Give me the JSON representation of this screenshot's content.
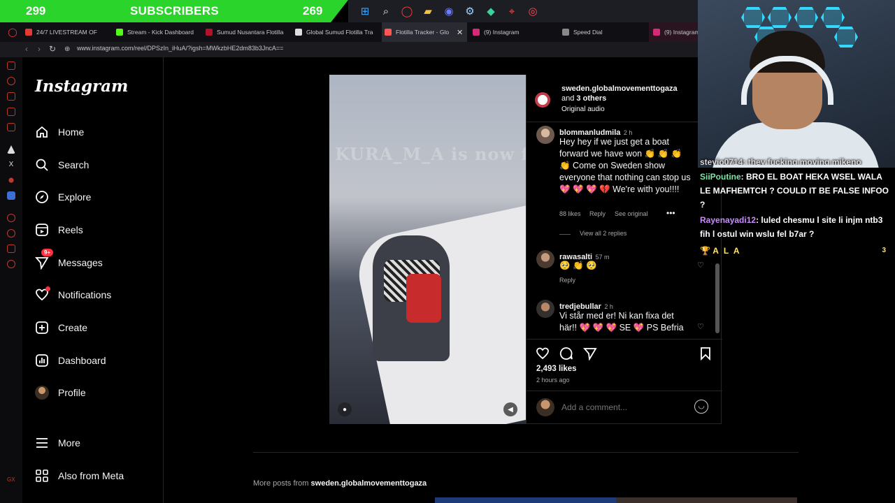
{
  "stream_overlay": {
    "left_count": "299",
    "label": "SUBSCRIBERS",
    "right_count": "269"
  },
  "browser": {
    "tabs": [
      {
        "label": "24/7 LIVESTREAM OF",
        "color": "#e53935"
      },
      {
        "label": "Stream - Kick Dashboard",
        "color": "#53fc18"
      },
      {
        "label": "Sumud Nusantara Flotilla",
        "color": "#b0132a"
      },
      {
        "label": "Global Sumud Flotilla Tra",
        "color": "#dddddd"
      },
      {
        "label": "Flotilla Tracker - Glo",
        "color": "#ff5555"
      },
      {
        "label": "(9) Instagram",
        "color": "#d62976"
      },
      {
        "label": "Speed Dial",
        "color": "#888888"
      },
      {
        "label": "(9) Instagram",
        "color": "#d62976"
      }
    ],
    "url": "www.instagram.com/reel/DPSzIn_iHuA/?igsh=MWkzbHE2dm83b3JncA=="
  },
  "sidebar": {
    "logo": "Instagram",
    "items": [
      {
        "label": "Home",
        "icon": "home-icon"
      },
      {
        "label": "Search",
        "icon": "search-icon"
      },
      {
        "label": "Explore",
        "icon": "compass-icon"
      },
      {
        "label": "Reels",
        "icon": "reels-icon"
      },
      {
        "label": "Messages",
        "icon": "messages-icon",
        "badge": "9+"
      },
      {
        "label": "Notifications",
        "icon": "heart-icon"
      },
      {
        "label": "Create",
        "icon": "plus-square-icon"
      },
      {
        "label": "Dashboard",
        "icon": "chart-icon"
      },
      {
        "label": "Profile",
        "icon": "avatar"
      }
    ],
    "more": "More",
    "meta": "Also from Meta"
  },
  "video": {
    "overlay_text": "KURA_M_A is now following!"
  },
  "post": {
    "author": "sweden.globalmovementtogaza",
    "coauthors_prefix": "and ",
    "coauthors": "3 others",
    "audio": "Original audio",
    "comments": [
      {
        "user": "blommanludmila",
        "time": "2 h",
        "text": "Hey hey if we just get a boat forward we have won 👏 👏 👏 👏 Come on Sweden show everyone that nothing can stop us 💖 💖 💖 💔 We're with you!!!!",
        "likes": "88 likes",
        "reply": "Reply",
        "translate": "See original",
        "view_replies": "View all 2 replies"
      },
      {
        "user": "rawasalti",
        "time": "57 m",
        "text": "🥺 👏 🥺",
        "reply": "Reply"
      },
      {
        "user": "tredjebullar",
        "time": "2 h",
        "text": "Vi står med er! Ni kan fixa det här!! 💖 💖 💖 SE 💖 PS Befria"
      }
    ],
    "likes": "2,493 likes",
    "posted": "2 hours ago",
    "comment_placeholder": "Add a comment..."
  },
  "more_posts": {
    "prefix": "More posts from ",
    "account": "sweden.globalmovementtogaza"
  },
  "chat": [
    {
      "user": "stevio0714",
      "text": ": they fucking moving mikeno",
      "color": "#ffffff"
    },
    {
      "user": "SiiPoutine",
      "text": ": BRO EL BOAT HEKA WSEL WALA LE MAFHEMTCH ? COULD IT BE FALSE INFOO ?",
      "color": "#7ee6a3"
    },
    {
      "user": "Rayenayadi12",
      "text": ": luled chesmu l site li injm ntb3 fih l ostul win wslu fel b7ar ?",
      "color": "#c98cff"
    },
    {
      "user": "A L A",
      "text": "",
      "color": "#ffe36b",
      "count": "3"
    }
  ]
}
